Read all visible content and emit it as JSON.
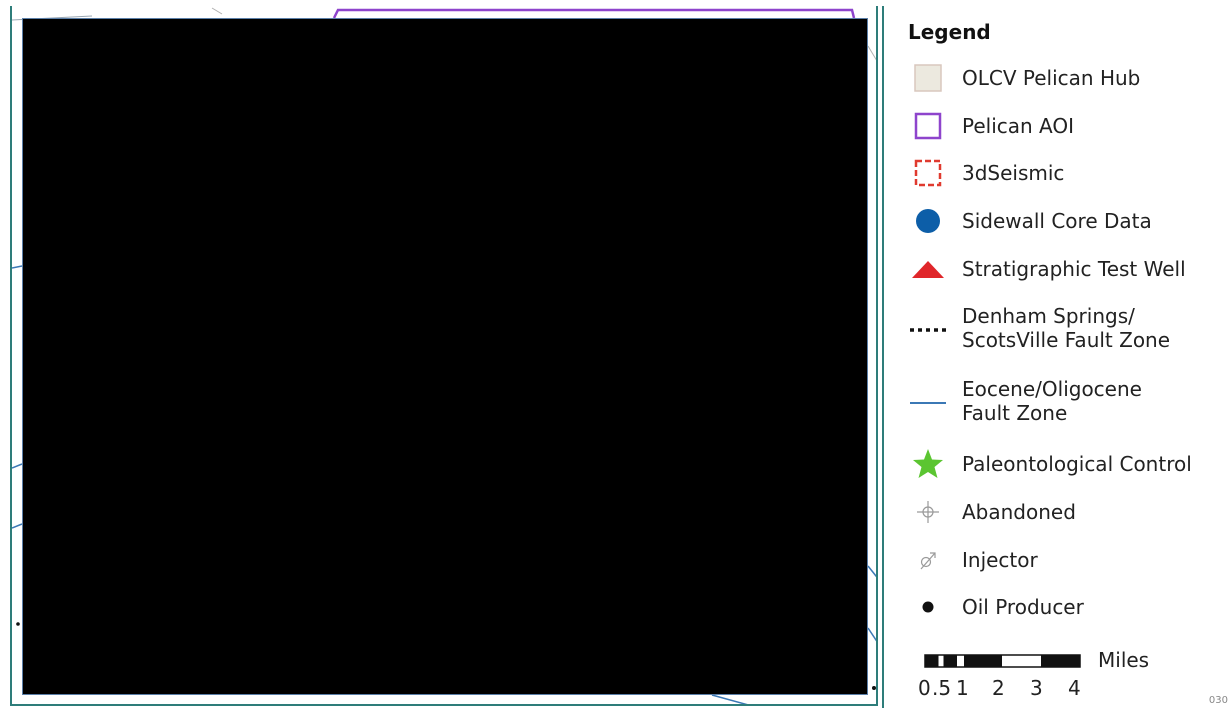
{
  "legend": {
    "title": "Legend",
    "items": [
      {
        "label": "OLCV Pelican Hub",
        "icon": "hub-area-swatch-icon",
        "color": "#ece9df"
      },
      {
        "label": "Pelican AOI",
        "icon": "aoi-outline-swatch-icon",
        "color": "#8e44cc"
      },
      {
        "label": "3dSeismic",
        "icon": "seismic-dashed-swatch-icon",
        "color": "#e03a2f"
      },
      {
        "label": "Sidewall Core Data",
        "icon": "blue-circle-icon",
        "color": "#0d5ea8"
      },
      {
        "label": "Stratigraphic Test Well",
        "icon": "red-triangle-icon",
        "color": "#e0262a"
      },
      {
        "label": "Denham Springs/\nScotsVille Fault Zone",
        "icon": "dotted-line-icon",
        "color": "#111111"
      },
      {
        "label": "Eocene/Oligocene\nFault Zone",
        "icon": "blue-line-icon",
        "color": "#3b78b5"
      },
      {
        "label": "Paleontological Control",
        "icon": "green-star-icon",
        "color": "#5bc531"
      },
      {
        "label": "Abandoned",
        "icon": "abandoned-well-icon",
        "color": "#9a9a9a"
      },
      {
        "label": "Injector",
        "icon": "injector-well-icon",
        "color": "#9a9a9a"
      },
      {
        "label": "Oil Producer",
        "icon": "oil-producer-dot-icon",
        "color": "#111111"
      }
    ]
  },
  "scale_bar": {
    "unit": "Miles",
    "ticks": [
      "0",
      ".5",
      "1",
      "2",
      "3",
      "4"
    ]
  },
  "corner_tag": "030"
}
